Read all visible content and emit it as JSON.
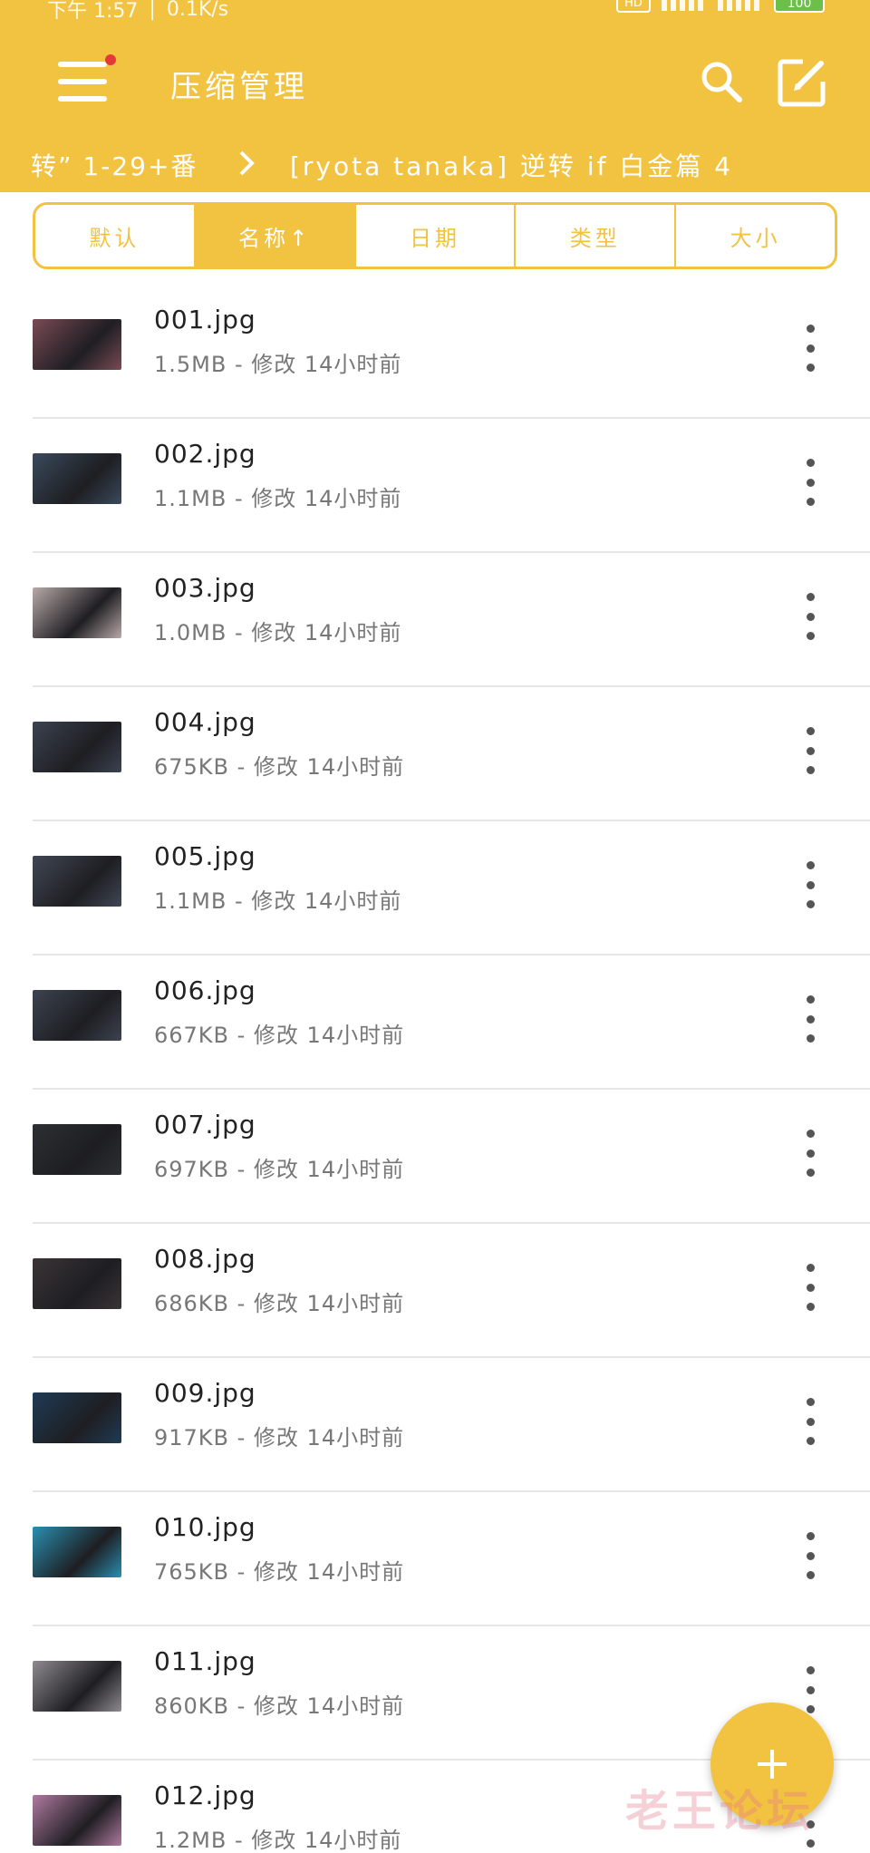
{
  "status_bar": {
    "time": "下午 1:57",
    "speed": "0.1K/s",
    "battery": "100"
  },
  "app": {
    "title": "压缩管理"
  },
  "path": {
    "previous": "转” 1-29+番",
    "separator": ">",
    "current": "[ryota tanaka] 逆转 if 白金篇 4"
  },
  "sort_tabs": [
    {
      "label": "默认"
    },
    {
      "label": "名称↑"
    },
    {
      "label": "日期"
    },
    {
      "label": "类型"
    },
    {
      "label": "大小"
    }
  ],
  "active_sort": 1,
  "files": [
    {
      "name": "001.jpg",
      "meta": "1.5MB - 修改 14小时前"
    },
    {
      "name": "002.jpg",
      "meta": "1.1MB - 修改 14小时前"
    },
    {
      "name": "003.jpg",
      "meta": "1.0MB - 修改 14小时前"
    },
    {
      "name": "004.jpg",
      "meta": "675KB - 修改 14小时前"
    },
    {
      "name": "005.jpg",
      "meta": "1.1MB - 修改 14小时前"
    },
    {
      "name": "006.jpg",
      "meta": "667KB - 修改 14小时前"
    },
    {
      "name": "007.jpg",
      "meta": "697KB - 修改 14小时前"
    },
    {
      "name": "008.jpg",
      "meta": "686KB - 修改 14小时前"
    },
    {
      "name": "009.jpg",
      "meta": "917KB - 修改 14小时前"
    },
    {
      "name": "010.jpg",
      "meta": "765KB - 修改 14小时前"
    },
    {
      "name": "011.jpg",
      "meta": "860KB - 修改 14小时前"
    },
    {
      "name": "012.jpg",
      "meta": "1.2MB - 修改 14小时前"
    }
  ],
  "watermark": "老王论坛",
  "colors": {
    "accent": "#f2c241",
    "thumbs": [
      "#7a4a55",
      "#3a4a5c",
      "#b8a9a8",
      "#3b4250",
      "#404754",
      "#3c4350",
      "#2c2f33",
      "#3a3436",
      "#1f3b55",
      "#2a8fb0",
      "#8e8a90",
      "#b07aa0"
    ]
  },
  "icons": {
    "menu": "hamburger-icon",
    "search": "search-icon",
    "edit": "edit-icon",
    "more": "more-vertical-icon",
    "fab": "plus-icon"
  }
}
